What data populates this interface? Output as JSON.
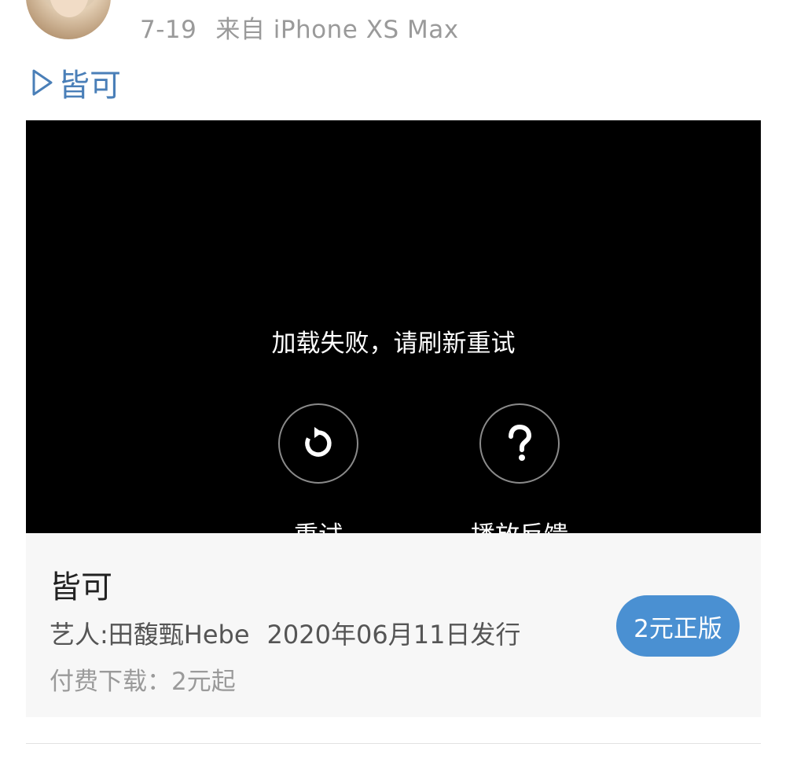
{
  "post": {
    "time": "7-19",
    "source": "来自 iPhone XS Max"
  },
  "link": {
    "icon": "play-outline-icon",
    "title": "皆可"
  },
  "video": {
    "error_message": "加载失败，请刷新重试",
    "retry_label": "重试",
    "retry_icon": "retry-icon",
    "feedback_label": "播放反馈",
    "feedback_icon": "question-icon"
  },
  "music_card": {
    "title": "皆可",
    "artist": "艺人:田馥甄Hebe",
    "release": "2020年06月11日发行",
    "price_note": "付费下载：2元起",
    "buy_button": "2元正版"
  },
  "colors": {
    "link": "#4a7fb8",
    "button": "#4a90d2",
    "video_bg": "#000000",
    "card_bg": "#f7f7f7"
  }
}
